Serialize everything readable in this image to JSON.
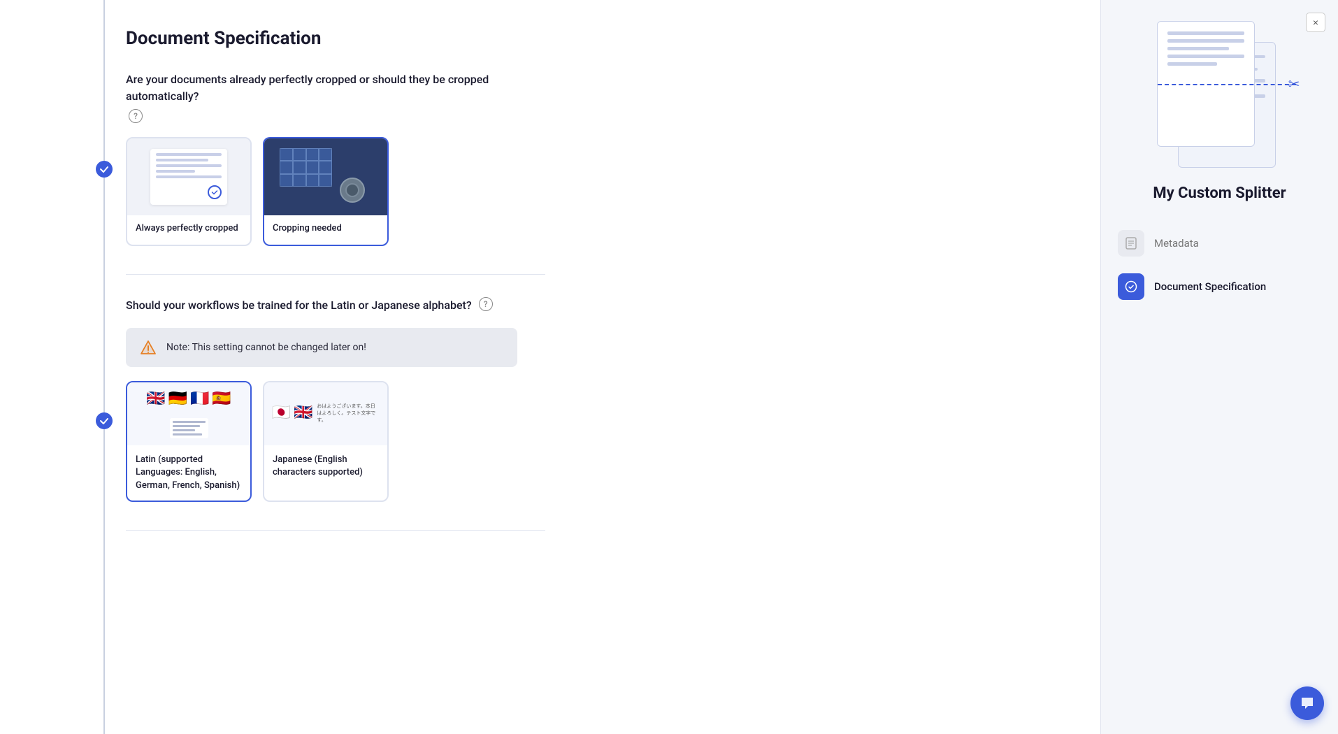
{
  "page": {
    "title": "Document Specification"
  },
  "section1": {
    "question": "Are your documents already perfectly cropped or should they be cropped automatically?",
    "cards": [
      {
        "id": "always-cropped",
        "label": "Always perfectly cropped",
        "selected": false
      },
      {
        "id": "cropping-needed",
        "label": "Cropping needed",
        "selected": true
      }
    ]
  },
  "section2": {
    "question": "Should your workflows be trained for the Latin or Japanese alphabet?",
    "warning": "Note: This setting cannot be changed later on!",
    "cards": [
      {
        "id": "latin",
        "label": "Latin (supported Languages: English, German, French, Spanish)",
        "selected": true,
        "flags": [
          "🇬🇧",
          "🇩🇪",
          "🇫🇷",
          "🇪🇸"
        ]
      },
      {
        "id": "japanese",
        "label": "Japanese (English characters supported)",
        "selected": false,
        "flags": [
          "🇯🇵",
          "🇬🇧"
        ]
      }
    ]
  },
  "panel": {
    "title": "My Custom Splitter",
    "close_label": "×",
    "steps": [
      {
        "id": "metadata",
        "label": "Metadata",
        "active": false
      },
      {
        "id": "document-specification",
        "label": "Document Specification",
        "active": true
      }
    ]
  },
  "icons": {
    "check": "✓",
    "warning": "⚠",
    "scissors": "✂",
    "close": "×",
    "chat": "💬",
    "gear": "⚙",
    "file": "📄"
  }
}
